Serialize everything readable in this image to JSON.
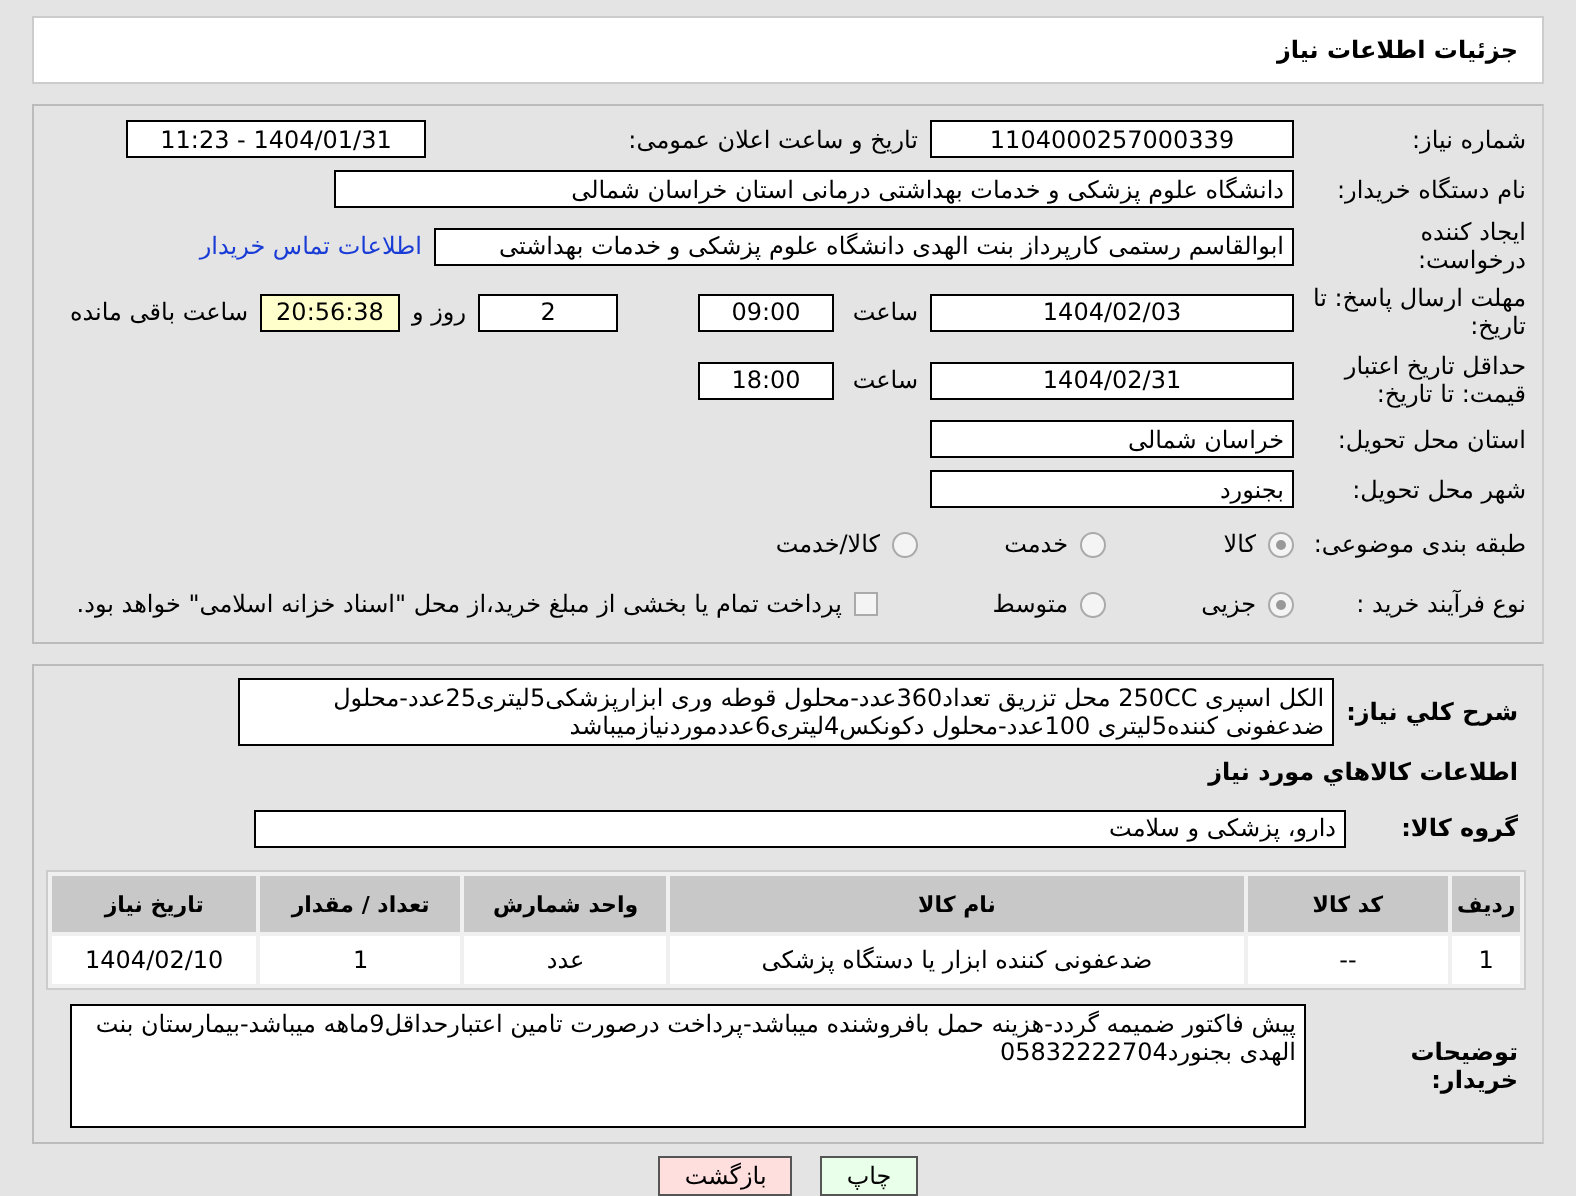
{
  "header": {
    "title": "جزئیات اطلاعات نیاز"
  },
  "need_number": {
    "label": "شماره نیاز:",
    "value": "1104000257000339"
  },
  "announce": {
    "label": "تاریخ و ساعت اعلان عمومی:",
    "value": "1404/01/31 - 11:23"
  },
  "buyer_org": {
    "label": "نام دستگاه خریدار:",
    "value": "دانشگاه علوم پزشکی و خدمات بهداشتی درمانی استان خراسان شمالی"
  },
  "creator": {
    "label": "ایجاد کننده درخواست:",
    "value": "ابوالقاسم رستمی کارپرداز بنت الهدی دانشگاه علوم پزشکی و خدمات بهداشتی",
    "link": "اطلاعات تماس خریدار"
  },
  "deadline": {
    "label": "مهلت ارسال پاسخ: تا تاریخ:",
    "date": "1404/02/03",
    "time_label": "ساعت",
    "time": "09:00",
    "days": "2",
    "days_label": "روز و",
    "remaining": "20:56:38",
    "remaining_label": "ساعت باقی مانده"
  },
  "validity": {
    "label": "حداقل تاریخ اعتبار قیمت: تا تاریخ:",
    "date": "1404/02/31",
    "time_label": "ساعت",
    "time": "18:00"
  },
  "province": {
    "label": "استان محل تحویل:",
    "value": "خراسان شمالی"
  },
  "city": {
    "label": "شهر محل تحویل:",
    "value": "بجنورد"
  },
  "category": {
    "label": "طبقه بندی موضوعی:",
    "options": [
      {
        "label": "کالا",
        "selected": true
      },
      {
        "label": "خدمت",
        "selected": false
      },
      {
        "label": "کالا/خدمت",
        "selected": false
      }
    ]
  },
  "process": {
    "label": "نوع فرآیند خرید :",
    "options": [
      {
        "label": "جزیی",
        "selected": true
      },
      {
        "label": "متوسط",
        "selected": false
      }
    ],
    "treasury": {
      "label": "پرداخت تمام یا بخشی از مبلغ خرید،از محل \"اسناد خزانه اسلامی\" خواهد بود.",
      "checked": false
    }
  },
  "summary": {
    "label": "شرح کلي نياز:",
    "value": "الکل اسپری 250CC محل تزریق تعداد360عدد-محلول قوطه وری ابزارپزشکی5لیتری25عدد-محلول ضدعفونی کننده5لیتری 100عدد-محلول دکونکس4لیتری6عددموردنیازمیباشد"
  },
  "goods_title": "اطلاعات کالاهاي مورد نياز",
  "goods_group": {
    "label": "گروه کالا:",
    "value": "دارو، پزشکی و سلامت"
  },
  "table": {
    "columns": [
      "ردیف",
      "کد کالا",
      "نام کالا",
      "واحد شمارش",
      "تعداد / مقدار",
      "تاریخ نیاز"
    ],
    "rows": [
      [
        "1",
        "--",
        "ضدعفونی کننده ابزار یا دستگاه پزشکی",
        "عدد",
        "1",
        "1404/02/10"
      ]
    ]
  },
  "notes": {
    "label": "توضیحات خریدار:",
    "value": "پیش فاکتور ضمیمه گردد-هزینه حمل بافروشنده میباشد-پرداخت درصورت تامین اعتبارحداقل9ماهه میباشد-بیمارستان بنت الهدی بجنورد05832222704"
  },
  "buttons": [
    {
      "label": "چاپ",
      "kind": "print"
    },
    {
      "label": "بازگشت",
      "kind": "back"
    }
  ]
}
